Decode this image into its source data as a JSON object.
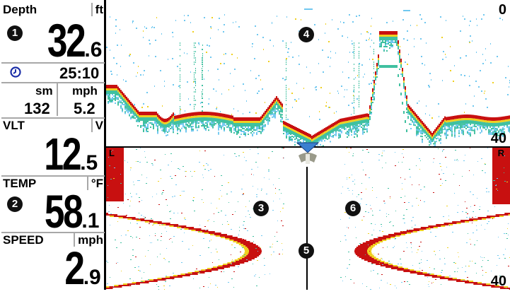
{
  "readouts": {
    "depth": {
      "label": "Depth",
      "unit": "ft",
      "int": "32",
      "dec": ".6",
      "callout": "1"
    },
    "timer": {
      "icon": "clock-icon",
      "value": "25:10"
    },
    "distance": {
      "unit": "sm",
      "value": "132"
    },
    "speed_small": {
      "unit": "mph",
      "value": "5.2"
    },
    "voltage": {
      "label": "VLT",
      "unit": "V",
      "int": "12",
      "dec": ".5"
    },
    "temp": {
      "label": "TEMP",
      "unit": "°F",
      "int": "58",
      "dec": ".1",
      "callout": "2"
    },
    "speed": {
      "label": "SPEED",
      "unit": "mph",
      "int": "2",
      "dec": ".9"
    }
  },
  "down_view": {
    "scale_top": "0",
    "scale_bottom": "40",
    "callout": "4"
  },
  "side_view": {
    "left_label": "L",
    "right_label": "R",
    "scale_bottom": "40",
    "callouts": {
      "left": "3",
      "center": "5",
      "right": "6"
    }
  },
  "colors": {
    "strong_return": "#c81010",
    "medium_return": "#f0d020",
    "weak_return": "#40c0a0",
    "faint_return": "#70c8f0",
    "boat_icon": "#3a7fd0"
  }
}
